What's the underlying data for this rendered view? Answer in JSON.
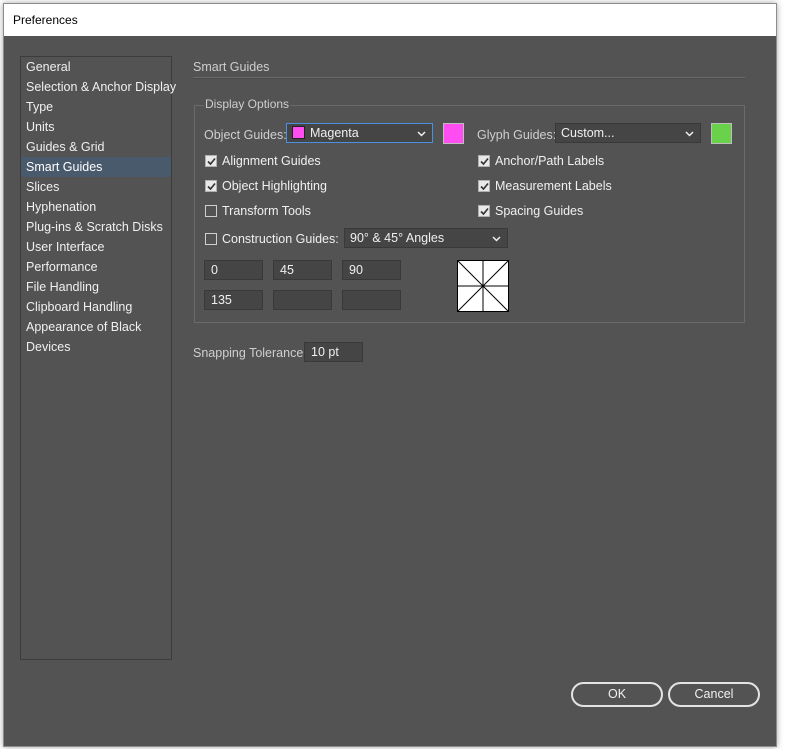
{
  "window": {
    "title": "Preferences"
  },
  "sidebar": {
    "items": [
      {
        "label": "General"
      },
      {
        "label": "Selection & Anchor Display"
      },
      {
        "label": "Type"
      },
      {
        "label": "Units"
      },
      {
        "label": "Guides & Grid"
      },
      {
        "label": "Smart Guides",
        "selected": true
      },
      {
        "label": "Slices"
      },
      {
        "label": "Hyphenation"
      },
      {
        "label": "Plug-ins & Scratch Disks"
      },
      {
        "label": "User Interface"
      },
      {
        "label": "Performance"
      },
      {
        "label": "File Handling"
      },
      {
        "label": "Clipboard Handling"
      },
      {
        "label": "Appearance of Black"
      },
      {
        "label": "Devices"
      }
    ]
  },
  "panel": {
    "title": "Smart Guides",
    "display_options": {
      "label": "Display Options",
      "object_guides": {
        "label": "Object Guides:",
        "value": "Magenta",
        "color": "#ff4df2"
      },
      "glyph_guides": {
        "label": "Glyph Guides:",
        "value": "Custom...",
        "color": "#6ad14a"
      },
      "checkboxes": {
        "alignment_guides": {
          "label": "Alignment Guides",
          "checked": true
        },
        "object_highlighting": {
          "label": "Object Highlighting",
          "checked": true
        },
        "transform_tools": {
          "label": "Transform Tools",
          "checked": false
        },
        "anchor_path_labels": {
          "label": "Anchor/Path Labels",
          "checked": true
        },
        "measurement_labels": {
          "label": "Measurement Labels",
          "checked": true
        },
        "spacing_guides": {
          "label": "Spacing Guides",
          "checked": true
        }
      },
      "construction_guides": {
        "label": "Construction Guides:",
        "checked": false,
        "value": "90° & 45° Angles"
      },
      "angles": [
        "0",
        "45",
        "90",
        "135",
        "",
        ""
      ]
    },
    "snapping_tolerance": {
      "label": "Snapping Tolerance:",
      "value": "10 pt"
    }
  },
  "buttons": {
    "ok": "OK",
    "cancel": "Cancel"
  }
}
